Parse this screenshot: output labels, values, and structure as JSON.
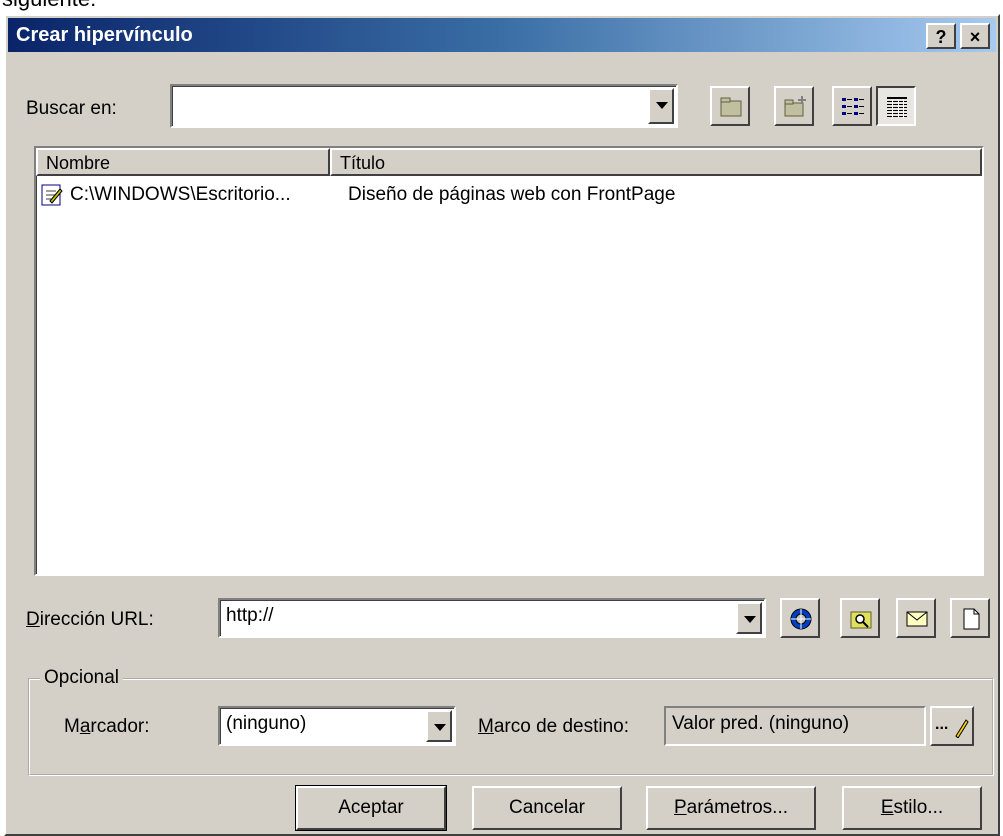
{
  "top_caption": "siguiente:",
  "dialog": {
    "title": "Crear hipervínculo",
    "help_button": "?",
    "close_button": "×"
  },
  "look_in": {
    "label": "Buscar en:",
    "value": ""
  },
  "toolbar": {
    "icons": [
      "up-folder-icon",
      "new-folder-icon",
      "list-view-icon",
      "details-view-icon"
    ]
  },
  "file_list": {
    "columns": [
      "Nombre",
      "Título"
    ],
    "rows": [
      {
        "name": "C:\\WINDOWS\\Escritorio...",
        "title": "Diseño de páginas web con FrontPage"
      }
    ]
  },
  "url": {
    "label_underlined": "D",
    "label_rest": "irección URL:",
    "value": "http://",
    "icons": [
      "web-browse-icon",
      "file-search-icon",
      "email-icon",
      "new-page-icon"
    ]
  },
  "optional": {
    "group_label": "Opcional",
    "bookmark_label_pre": "M",
    "bookmark_label_underlined": "a",
    "bookmark_label_post": "rcador:",
    "bookmark_value": "(ninguno)",
    "target_label_underlined": "M",
    "target_label_rest": "arco de destino:",
    "target_value": "Valor pred. (ninguno)",
    "target_button": "..."
  },
  "buttons": {
    "ok": "Aceptar",
    "cancel": "Cancelar",
    "params_underlined": "P",
    "params_rest": "arámetros...",
    "style_underlined": "E",
    "style_rest": "stilo..."
  }
}
